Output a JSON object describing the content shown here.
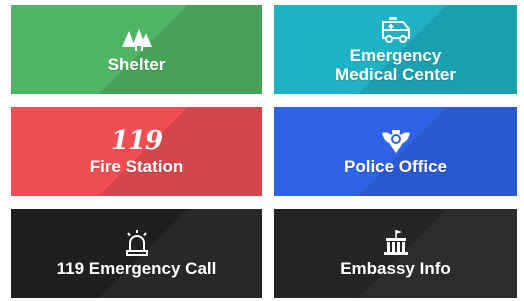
{
  "tiles": {
    "shelter": {
      "label": "Shelter",
      "icon": "tents-icon"
    },
    "medical": {
      "label_line1": "Emergency",
      "label_line2": "Medical Center",
      "icon": "ambulance-icon"
    },
    "fire": {
      "label": "Fire Station",
      "logo": "119"
    },
    "police": {
      "label": "Police Office",
      "icon": "police-badge-icon"
    },
    "call": {
      "label": "119 Emergency Call",
      "icon": "siren-icon"
    },
    "embassy": {
      "label": "Embassy Info",
      "icon": "embassy-building-icon"
    }
  },
  "colors": {
    "shelter": "#4fb463",
    "medical": "#1fb2c4",
    "fire": "#ee4d52",
    "police": "#2f63e6",
    "call": "#1f1f1f",
    "embassy": "#242424"
  }
}
